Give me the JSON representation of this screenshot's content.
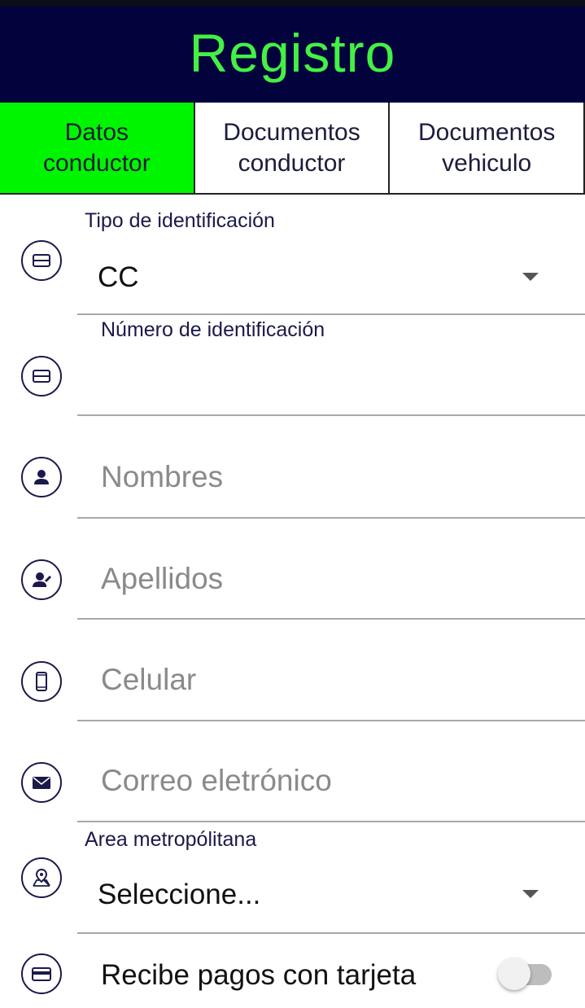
{
  "header": {
    "title": "Registro"
  },
  "tabs": [
    {
      "label": "Datos\nconductor",
      "active": true
    },
    {
      "label": "Documentos\nconductor",
      "active": false
    },
    {
      "label": "Documentos\nvehiculo",
      "active": false
    }
  ],
  "form": {
    "id_type": {
      "label": "Tipo de identificación",
      "value": "CC",
      "icon": "id-card-icon"
    },
    "id_number": {
      "label": "Número de identificación",
      "value": "",
      "icon": "id-card-icon"
    },
    "first_name": {
      "placeholder": "Nombres",
      "icon": "person-icon"
    },
    "last_name": {
      "placeholder": "Apellidos",
      "icon": "person-edit-icon"
    },
    "phone": {
      "placeholder": "Celular",
      "icon": "phone-icon"
    },
    "email": {
      "placeholder": "Correo eletrónico",
      "icon": "envelope-icon"
    },
    "metro_area": {
      "label": "Area metropólitana",
      "value": "Seleccione...",
      "icon": "map-pin-icon"
    },
    "card_payments": {
      "label": "Recibe pagos con tarjeta",
      "enabled": false,
      "icon": "credit-card-icon"
    }
  },
  "colors": {
    "header_bg": "#02023d",
    "title": "#44f044",
    "active_tab": "#00f500",
    "icon_stroke": "#1a1a4a"
  }
}
